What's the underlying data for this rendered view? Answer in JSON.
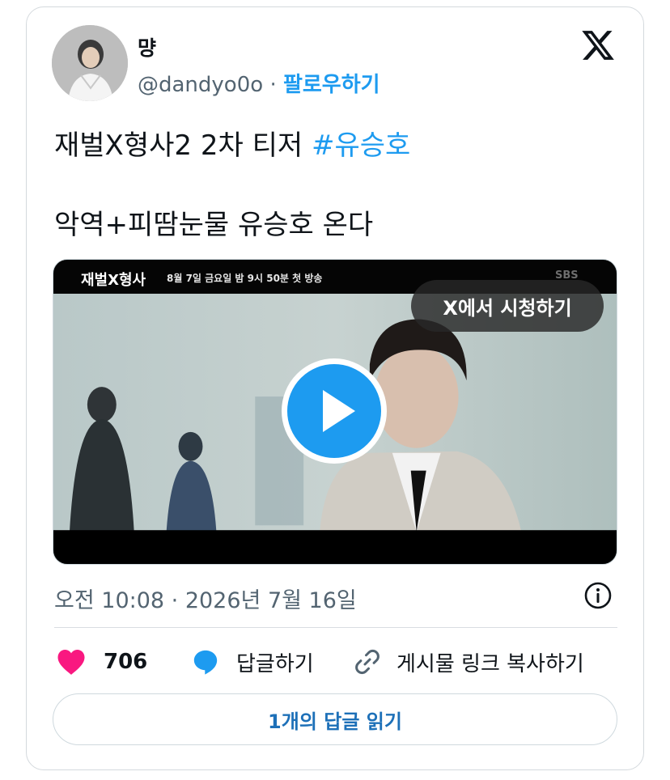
{
  "author": {
    "name": "먕",
    "handle": "@dandyo0o",
    "separator": "·",
    "follow_label": "팔로우하기"
  },
  "platform_icon": "x-logo-icon",
  "tweet": {
    "line1_text": "재벌X형사2 2차 티저 ",
    "line1_hashtag": "#유승호",
    "line2_text": "악역+피땀눈물 유승호 온다"
  },
  "media": {
    "banner_title": "재벌X형사",
    "banner_subtitle": "8월 7일 금요일 밤 9시 50분 첫 방송",
    "banner_corner": "SBS",
    "watch_label": "X에서 시청하기",
    "play_icon": "play-icon"
  },
  "meta": {
    "timestamp": "오전 10:08 · 2026년 7월 16일",
    "info_icon": "info-icon"
  },
  "actions": {
    "like_count": "706",
    "reply_label": "답글하기",
    "copy_label": "게시물 링크 복사하기"
  },
  "read_replies_label": "1개의 답글 읽기",
  "colors": {
    "accent": "#1d9bf0",
    "like": "#f91880",
    "muted": "#536471",
    "text": "#0f1419"
  }
}
